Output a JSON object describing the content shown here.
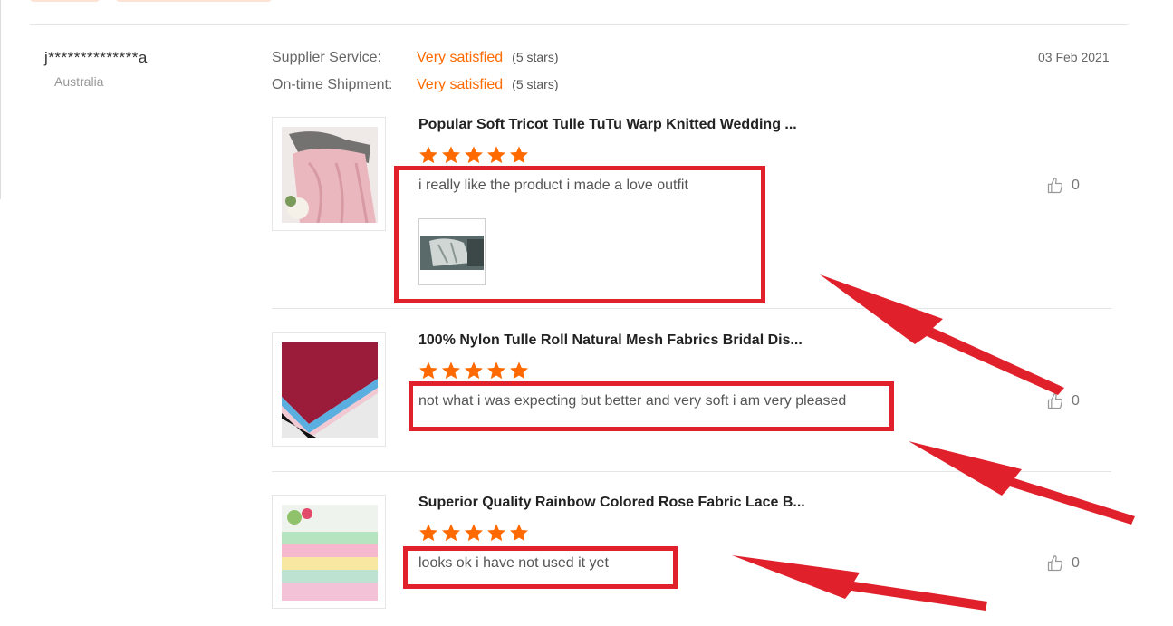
{
  "reviewer": {
    "name": "j**************a",
    "country": "Australia"
  },
  "ratings": [
    {
      "label": "Supplier Service:",
      "value": "Very satisfied",
      "stars": "(5 stars)"
    },
    {
      "label": "On-time Shipment:",
      "value": "Very satisfied",
      "stars": "(5 stars)"
    }
  ],
  "review_date": "03 Feb 2021",
  "products": [
    {
      "title": "Popular Soft Tricot Tulle TuTu Warp Knitted Wedding ...",
      "rating": 5,
      "comment": "i really like the product i made a love outfit",
      "like_count": "0",
      "has_attachment": true
    },
    {
      "title": "100% Nylon Tulle Roll Natural Mesh Fabrics Bridal Dis...",
      "rating": 5,
      "comment": "not what i was expecting but better and very soft i am very pleased",
      "like_count": "0",
      "has_attachment": false
    },
    {
      "title": "Superior Quality Rainbow Colored Rose Fabric Lace B...",
      "rating": 5,
      "comment": "looks ok i have not used it yet",
      "like_count": "0",
      "has_attachment": false
    }
  ],
  "icons": {
    "star": "star-icon",
    "like": "thumbs-up-icon"
  },
  "colors": {
    "accent": "#ff6a00",
    "highlight": "#e0212c",
    "star": "#ff6a00"
  }
}
